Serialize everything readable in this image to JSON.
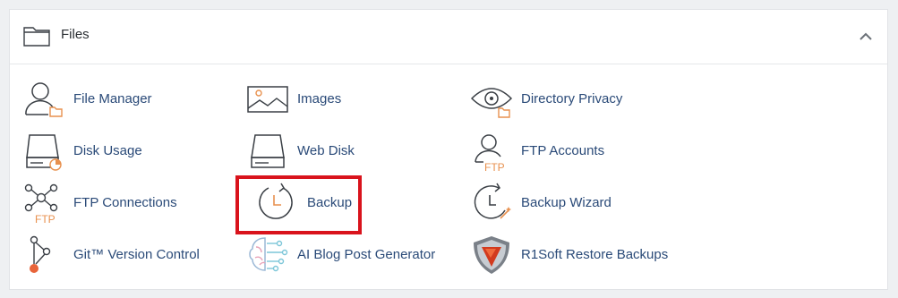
{
  "section": {
    "title": "Files",
    "icon": "folder-icon",
    "toggle_icon": "chevron-up-icon"
  },
  "colors": {
    "link": "#2a4a78",
    "icon_stroke": "#3a3f45",
    "icon_accent": "#e8914f",
    "highlight": "#d9131c"
  },
  "items": [
    {
      "label": "File Manager",
      "icon": "file-manager-icon"
    },
    {
      "label": "Images",
      "icon": "images-icon"
    },
    {
      "label": "Directory Privacy",
      "icon": "directory-privacy-icon"
    },
    {
      "label": "Disk Usage",
      "icon": "disk-usage-icon"
    },
    {
      "label": "Web Disk",
      "icon": "web-disk-icon"
    },
    {
      "label": "FTP Accounts",
      "icon": "ftp-accounts-icon",
      "icon_text": "FTP"
    },
    {
      "label": "FTP Connections",
      "icon": "ftp-connections-icon",
      "icon_text": "FTP"
    },
    {
      "label": "Backup",
      "icon": "backup-icon"
    },
    {
      "label": "Backup Wizard",
      "icon": "backup-wizard-icon"
    },
    {
      "label": "Git™ Version Control",
      "icon": "git-icon"
    },
    {
      "label": "AI Blog Post Generator",
      "icon": "ai-brain-icon"
    },
    {
      "label": "R1Soft Restore Backups",
      "icon": "r1soft-shield-icon"
    }
  ]
}
